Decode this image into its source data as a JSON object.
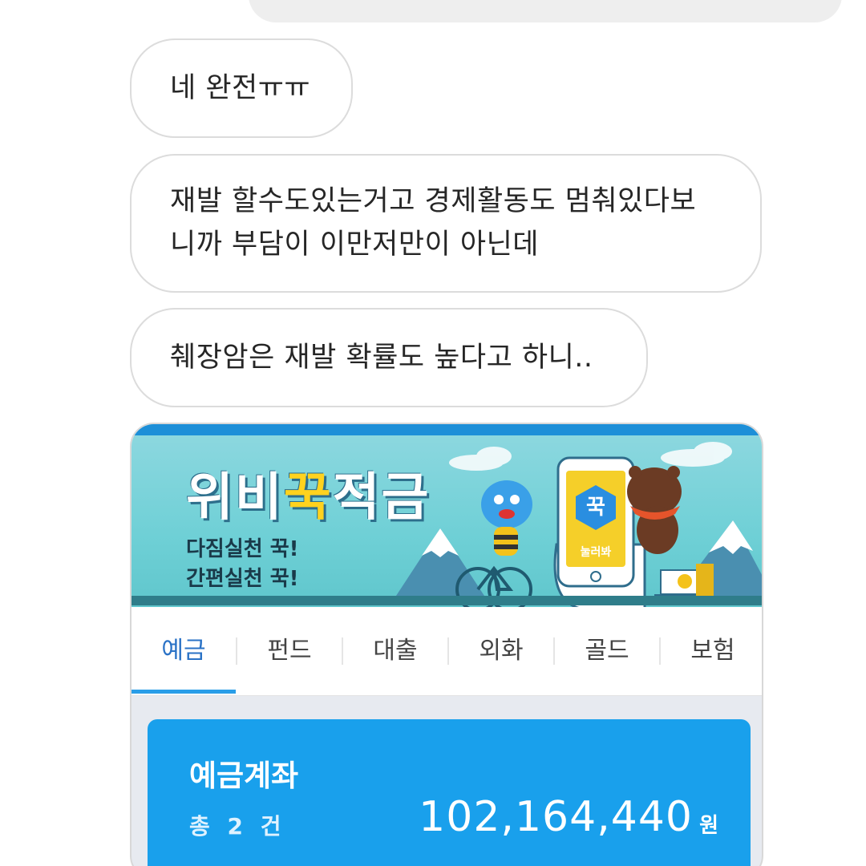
{
  "chat": {
    "messages": [
      {
        "lines": [
          "네 완전ㅠㅠ"
        ]
      },
      {
        "lines": [
          "재발 할수도있는거고 경제활동도 멈춰있다보",
          "니까 부담이 이만저만이 아닌데"
        ]
      },
      {
        "lines": [
          "췌장암은 재발 확률도 높다고 하니.."
        ]
      }
    ]
  },
  "attachment": {
    "banner": {
      "title_part1": "위비",
      "title_accent": "꾹",
      "title_part2": "적금",
      "subtitle_line1": "다짐실천 꾹!",
      "subtitle_line2": "간편실천 꾹!",
      "phone_badge": "꾹",
      "phone_badge_sub": "눌러봐",
      "colors": {
        "sky": "#8fd8e0",
        "accent": "#ffd21e",
        "topbar": "#1d8fd8"
      }
    },
    "tabs": [
      {
        "label": "예금",
        "active": true
      },
      {
        "label": "펀드",
        "active": false
      },
      {
        "label": "대출",
        "active": false
      },
      {
        "label": "외화",
        "active": false
      },
      {
        "label": "골드",
        "active": false
      },
      {
        "label": "보험",
        "active": false
      }
    ],
    "deposit": {
      "title": "예금계좌",
      "count_text": "총 2 건",
      "amount": "102,164,440",
      "unit": "원",
      "color": "#19a0ec"
    }
  }
}
